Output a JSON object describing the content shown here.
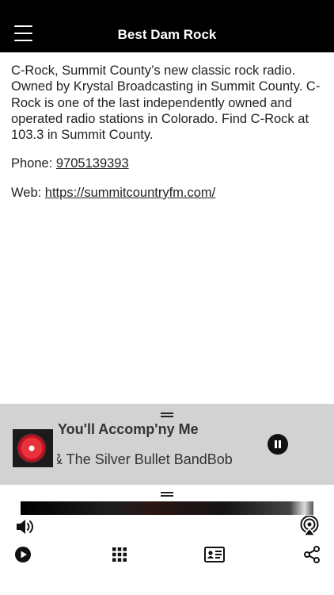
{
  "header": {
    "title": "Best Dam Rock",
    "menu_icon": "hamburger-menu-icon"
  },
  "content": {
    "description": "C-Rock, Summit County’s new classic rock radio. Owned by Krystal Broadcasting in Summit County. C-Rock is one of the last independently owned and operated radio stations in Colorado. Find C-Rock at 103.3 in Summit County.",
    "phone_label": "Phone: ",
    "phone": "9705139393",
    "web_label": "Web: ",
    "web": "https://summitcountryfm.com/"
  },
  "now_playing": {
    "song_title": "You'll Accomp'ny Me",
    "artist": "& The Silver Bullet BandBob",
    "state": "playing"
  },
  "toolbar": {
    "icons": [
      "volume-icon",
      "airplay-icon",
      "play-icon",
      "grid-icon",
      "contact-card-icon",
      "share-icon"
    ]
  },
  "colors": {
    "header_bg": "#000000",
    "now_playing_bg": "#d2d2d2",
    "text": "#1a1a1a"
  }
}
